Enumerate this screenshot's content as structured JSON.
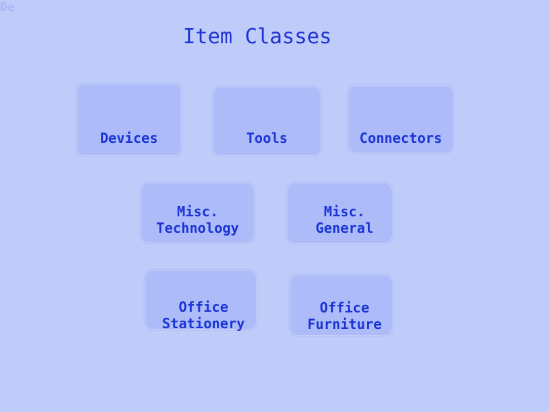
{
  "corner_text": "De",
  "page_title": "Item Classes",
  "tiles": {
    "devices": "Devices",
    "tools": "Tools",
    "connectors": "Connectors",
    "misc_technology": "Misc.\nTechnology",
    "misc_general": "Misc.\nGeneral",
    "office_stationery": "Office\nStationery",
    "office_furniture": "Office\nFurniture"
  }
}
